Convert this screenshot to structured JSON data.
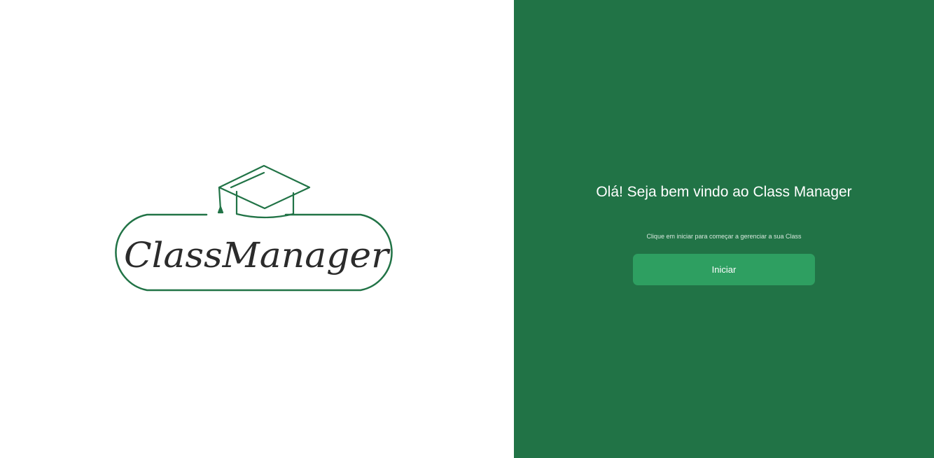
{
  "logo": {
    "text": "ClassManager",
    "icon": "graduation-cap-icon",
    "color": "#217346"
  },
  "welcome": {
    "title": "Olá! Seja bem vindo ao Class Manager",
    "subtitle": "Clique em iniciar para começar a gerenciar a sua Class",
    "button_label": "Iniciar"
  },
  "colors": {
    "panel_background": "#217346",
    "button_background": "#2e9f61",
    "left_background": "#ffffff"
  }
}
